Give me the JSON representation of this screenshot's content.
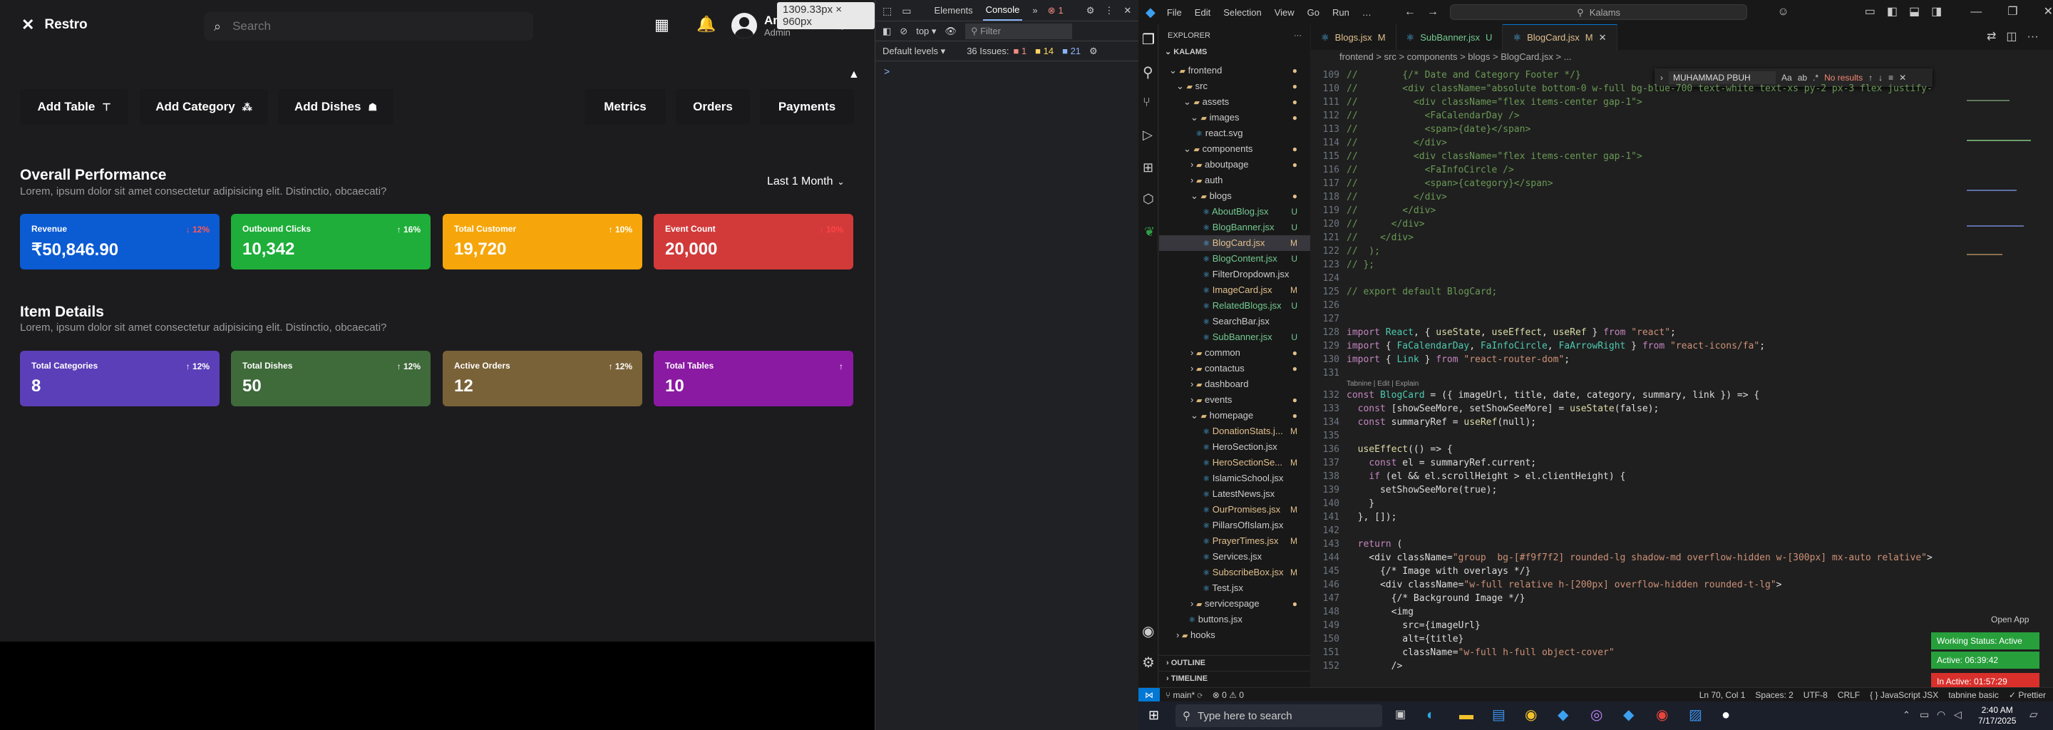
{
  "app": {
    "brand": "Restro",
    "search_placeholder": "Search",
    "user_name": "Amrit Raj",
    "user_role": "Admin",
    "size_badge": "1309.33px × 960px",
    "toolbar_left": [
      "Add Table",
      "Add Category",
      "Add Dishes"
    ],
    "toolbar_right": [
      "Metrics",
      "Orders",
      "Payments"
    ],
    "overall": {
      "title": "Overall Performance",
      "subtitle": "Lorem, ipsum dolor sit amet consectetur adipisicing elit. Distinctio, obcaecati?",
      "period": "Last 1 Month",
      "cards": [
        {
          "label": "Revenue",
          "trend": "↓ 12%",
          "value": "₹50,846.90",
          "color": "#0b5bd3",
          "trend_color": "#ff5a5a"
        },
        {
          "label": "Outbound Clicks",
          "trend": "↑ 16%",
          "value": "10,342",
          "color": "#1fae3a",
          "trend_color": "#ffffff"
        },
        {
          "label": "Total Customer",
          "trend": "↑ 10%",
          "value": "19,720",
          "color": "#f6a60b",
          "trend_color": "#ffffff"
        },
        {
          "label": "Event Count",
          "trend": "↓ 10%",
          "value": "20,000",
          "color": "#d23a3a",
          "trend_color": "#ff4444"
        }
      ]
    },
    "items": {
      "title": "Item Details",
      "subtitle": "Lorem, ipsum dolor sit amet consectetur adipisicing elit. Distinctio, obcaecati?",
      "cards": [
        {
          "label": "Total Categories",
          "trend": "↑ 12%",
          "value": "8",
          "color": "#5b3fb8",
          "trend_color": "#ffffff"
        },
        {
          "label": "Total Dishes",
          "trend": "↑ 12%",
          "value": "50",
          "color": "#3f6a3a",
          "trend_color": "#ffffff"
        },
        {
          "label": "Active Orders",
          "trend": "↑ 12%",
          "value": "12",
          "color": "#7a6238",
          "trend_color": "#ffffff"
        },
        {
          "label": "Total Tables",
          "trend": "↑",
          "value": "10",
          "color": "#8b1aa3",
          "trend_color": "#ffffff"
        }
      ]
    }
  },
  "devtools": {
    "tabs": [
      "Elements",
      "Console"
    ],
    "errors": "1",
    "context": "top",
    "filter_placeholder": "Filter",
    "levels": "Default levels",
    "issues_label": "36 Issues:",
    "issues_err": "1",
    "issues_warn": "14",
    "issues_info": "21",
    "prompt": ">"
  },
  "vscode": {
    "menu": [
      "File",
      "Edit",
      "Selection",
      "View",
      "Go",
      "Run",
      "…"
    ],
    "search_title": "Kalams",
    "tabs": [
      {
        "name": "Blogs.jsx",
        "state": "M"
      },
      {
        "name": "SubBanner.jsx",
        "state": "U"
      },
      {
        "name": "BlogCard.jsx",
        "state": "M"
      }
    ],
    "breadcrumb": "frontend > src > components > blogs > BlogCard.jsx > ...",
    "explorer_title": "EXPLORER",
    "root": "KALAMS",
    "tree": [
      {
        "label": "frontend",
        "depth": 1,
        "kind": "folder-open",
        "state": "dot"
      },
      {
        "label": "src",
        "depth": 2,
        "kind": "folder-open",
        "state": "dot"
      },
      {
        "label": "assets",
        "depth": 3,
        "kind": "folder-open",
        "state": "dot"
      },
      {
        "label": "images",
        "depth": 4,
        "kind": "folder-open",
        "state": "dot"
      },
      {
        "label": "react.svg",
        "depth": 4,
        "kind": "file",
        "state": ""
      },
      {
        "label": "components",
        "depth": 3,
        "kind": "folder-open",
        "state": "dot"
      },
      {
        "label": "aboutpage",
        "depth": 4,
        "kind": "folder",
        "state": "dot"
      },
      {
        "label": "auth",
        "depth": 4,
        "kind": "folder",
        "state": ""
      },
      {
        "label": "blogs",
        "depth": 4,
        "kind": "folder-open",
        "state": "dot"
      },
      {
        "label": "AboutBlog.jsx",
        "depth": 5,
        "kind": "file",
        "state": "U"
      },
      {
        "label": "BlogBanner.jsx",
        "depth": 5,
        "kind": "file",
        "state": "U"
      },
      {
        "label": "BlogCard.jsx",
        "depth": 5,
        "kind": "file",
        "state": "M"
      },
      {
        "label": "BlogContent.jsx",
        "depth": 5,
        "kind": "file",
        "state": "U"
      },
      {
        "label": "FilterDropdown.jsx",
        "depth": 5,
        "kind": "file",
        "state": ""
      },
      {
        "label": "ImageCard.jsx",
        "depth": 5,
        "kind": "file",
        "state": "M"
      },
      {
        "label": "RelatedBlogs.jsx",
        "depth": 5,
        "kind": "file",
        "state": "U"
      },
      {
        "label": "SearchBar.jsx",
        "depth": 5,
        "kind": "file",
        "state": ""
      },
      {
        "label": "SubBanner.jsx",
        "depth": 5,
        "kind": "file",
        "state": "U"
      },
      {
        "label": "common",
        "depth": 4,
        "kind": "folder",
        "state": "dot"
      },
      {
        "label": "contactus",
        "depth": 4,
        "kind": "folder",
        "state": "dot"
      },
      {
        "label": "dashboard",
        "depth": 4,
        "kind": "folder",
        "state": ""
      },
      {
        "label": "events",
        "depth": 4,
        "kind": "folder",
        "state": "dot"
      },
      {
        "label": "homepage",
        "depth": 4,
        "kind": "folder-open",
        "state": "dot"
      },
      {
        "label": "DonationStats.j...",
        "depth": 5,
        "kind": "file",
        "state": "M"
      },
      {
        "label": "HeroSection.jsx",
        "depth": 5,
        "kind": "file",
        "state": ""
      },
      {
        "label": "HeroSectionSe...",
        "depth": 5,
        "kind": "file",
        "state": "M"
      },
      {
        "label": "IslamicSchool.jsx",
        "depth": 5,
        "kind": "file",
        "state": ""
      },
      {
        "label": "LatestNews.jsx",
        "depth": 5,
        "kind": "file",
        "state": ""
      },
      {
        "label": "OurPromises.jsx",
        "depth": 5,
        "kind": "file",
        "state": "M"
      },
      {
        "label": "PillarsOfIslam.jsx",
        "depth": 5,
        "kind": "file",
        "state": ""
      },
      {
        "label": "PrayerTimes.jsx",
        "depth": 5,
        "kind": "file",
        "state": "M"
      },
      {
        "label": "Services.jsx",
        "depth": 5,
        "kind": "file",
        "state": ""
      },
      {
        "label": "SubscribeBox.jsx",
        "depth": 5,
        "kind": "file",
        "state": "M"
      },
      {
        "label": "Test.jsx",
        "depth": 5,
        "kind": "file",
        "state": ""
      },
      {
        "label": "servicespage",
        "depth": 4,
        "kind": "folder",
        "state": "dot"
      },
      {
        "label": "buttons.jsx",
        "depth": 3,
        "kind": "file",
        "state": ""
      },
      {
        "label": "hooks",
        "depth": 2,
        "kind": "folder",
        "state": ""
      }
    ],
    "outline_label": "OUTLINE",
    "timeline_label": "TIMELINE",
    "find_query": "MUHAMMAD PBUH",
    "find_result": "No results",
    "tabnine_lens": "Tabnine | Edit | Explain",
    "code_start": 109,
    "code_lines": [
      "//        {/* Date and Category Footer */}",
      "//        <div className=\"absolute bottom-0 w-full bg-blue-700 text-white text-xs py-2 px-3 flex justify-",
      "//          <div className=\"flex items-center gap-1\">",
      "//            <FaCalendarDay />",
      "//            <span>{date}</span>",
      "//          </div>",
      "//          <div className=\"flex items-center gap-1\">",
      "//            <FaInfoCircle />",
      "//            <span>{category}</span>",
      "//          </div>",
      "//        </div>",
      "//      </div>",
      "//    </div>",
      "//  );",
      "// };",
      "",
      "// export default BlogCard;",
      "",
      "",
      "import React, { useState, useEffect, useRef } from \"react\";",
      "import { FaCalendarDay, FaInfoCircle, FaArrowRight } from \"react-icons/fa\";",
      "import { Link } from \"react-router-dom\";",
      "",
      "const BlogCard = ({ imageUrl, title, date, category, summary, link }) => {",
      "  const [showSeeMore, setShowSeeMore] = useState(false);",
      "  const summaryRef = useRef(null);",
      "",
      "  useEffect(() => {",
      "    const el = summaryRef.current;",
      "    if (el && el.scrollHeight > el.clientHeight) {",
      "      setShowSeeMore(true);",
      "    }",
      "  }, []);",
      "",
      "  return (",
      "    <div className=\"group  bg-[#f9f7f2] rounded-lg shadow-md overflow-hidden w-[300px] mx-auto relative\">",
      "      {/* Image with overlays */}",
      "      <div className=\"w-full relative h-[200px] overflow-hidden rounded-t-lg\">",
      "        {/* Background Image */}",
      "        <img",
      "          src={imageUrl}",
      "          alt={title}",
      "          className=\"w-full h-full object-cover\"",
      "        />"
    ],
    "status": {
      "branch": "main*",
      "problems": "⊗ 0 ⚠ 0",
      "position": "Ln 70, Col 1",
      "spaces": "Spaces: 2",
      "encoding": "UTF-8",
      "eol": "CRLF",
      "language": "JavaScript JSX",
      "tabnine": "tabnine basic",
      "prettier": "Prettier"
    },
    "open_app": "Open App",
    "working_status": "Working Status: Active",
    "active_time": "Active: 06:39:42",
    "inactive_time": "In Active: 01:57:29"
  },
  "taskbar": {
    "search_placeholder": "Type here to search",
    "time": "2:40 AM",
    "date": "7/17/2025"
  }
}
